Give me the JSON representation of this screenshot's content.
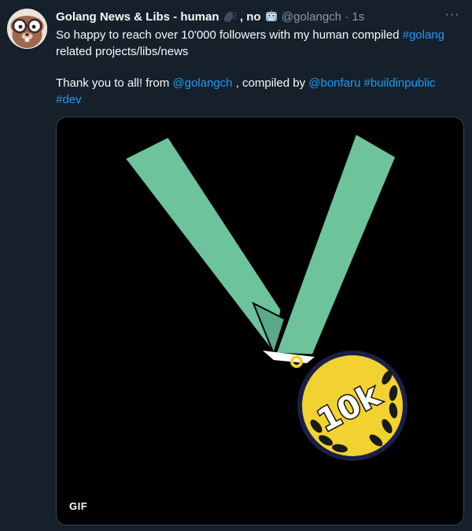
{
  "tweet": {
    "author_name": "Golang News & Libs - human",
    "author_name_suffix": ", no",
    "handle": "@golangch",
    "separator": "·",
    "time": "1s",
    "more_label": "···",
    "text": {
      "line1_prefix": "So happy to reach over 10'000 followers with my human compiled ",
      "tag_golang": "#golang",
      "line2": "related projects/libs/news",
      "thanks_prefix": "Thank you to all! from ",
      "mention_golangch": "@golangch",
      "compiled_by": " , compiled by  ",
      "mention_bonfaru": "@bonfaru",
      "tag_buildinpublic": "#buildinpublic",
      "tag_dev": "#dev"
    },
    "media": {
      "badge": "GIF",
      "medal_text": "10k"
    }
  },
  "colors": {
    "background": "#15202b",
    "link": "#1d9bf0",
    "secondary": "#8b98a5",
    "ribbon": "#6cc39c",
    "medal": "#f2d230"
  }
}
